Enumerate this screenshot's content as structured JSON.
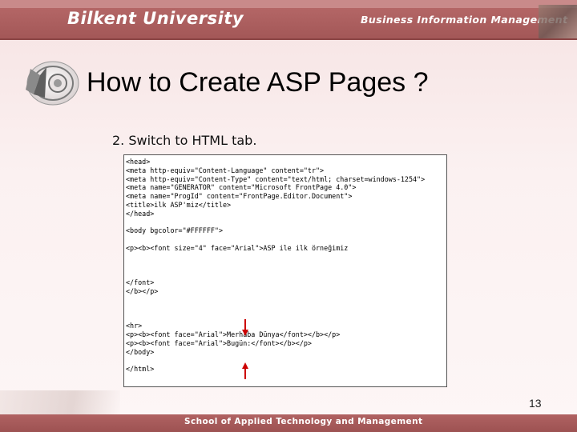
{
  "header": {
    "university": "Bilkent University",
    "department": "Business Information Management"
  },
  "slide": {
    "title": "How to Create ASP Pages ?",
    "step": "2. Switch to HTML tab.",
    "code_lines": [
      "<head>",
      "<meta http-equiv=\"Content-Language\" content=\"tr\">",
      "<meta http-equiv=\"Content-Type\" content=\"text/html; charset=windows-1254\">",
      "<meta name=\"GENERATOR\" content=\"Microsoft FrontPage 4.0\">",
      "<meta name=\"ProgId\" content=\"FrontPage.Editor.Document\">",
      "<title>ilk ASP'miz</title>",
      "</head>",
      "",
      "<body bgcolor=\"#FFFFFF\">",
      "",
      "<p><b><font size=\"4\" face=\"Arial\">ASP ile ilk örneğimiz",
      "",
      "",
      "",
      "</font>",
      "</b></p>",
      "",
      "",
      "",
      "<hr>",
      "<p><b><font face=\"Arial\">Merhaba Dünya</font></b></p>",
      "<p><b><font face=\"Arial\">Bugün:</font></b></p>",
      "</body>",
      "",
      "</html>"
    ],
    "arrow_color": "#cc0000"
  },
  "footer": {
    "text": "School of Applied Technology and Management",
    "page_number": "13"
  },
  "colors": {
    "header": "#a35757",
    "background": "#f8e8e8"
  }
}
